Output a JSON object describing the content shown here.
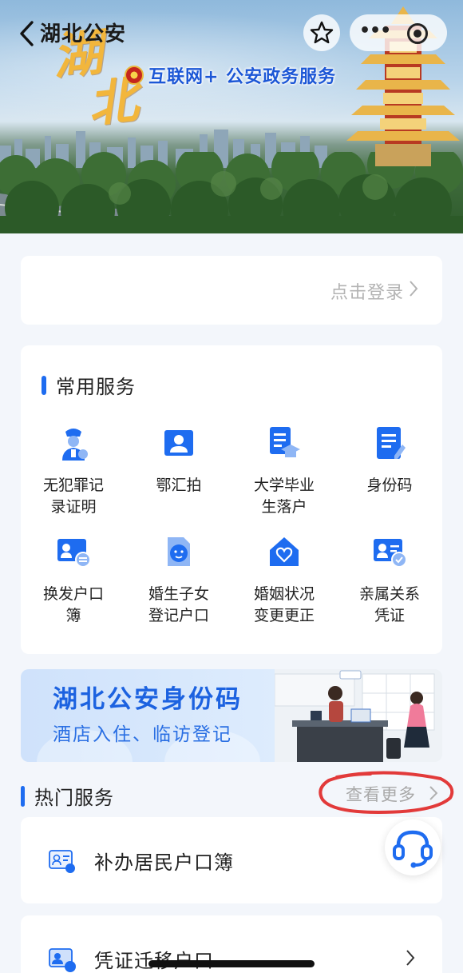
{
  "header": {
    "title": "湖北公安"
  },
  "banner": {
    "big_text_1": "湖",
    "big_text_2": "北",
    "slogan": "互联网+ 公安政务服务"
  },
  "login": {
    "label": "点击登录"
  },
  "common_services": {
    "title": "常用服务",
    "items": [
      {
        "label": "无犯罪记\n录证明",
        "icon": "police-officer-icon"
      },
      {
        "label": "鄂汇拍",
        "icon": "portrait-photo-icon"
      },
      {
        "label": "大学毕业\n生落户",
        "icon": "graduation-document-icon"
      },
      {
        "label": "身份码",
        "icon": "id-code-document-icon"
      },
      {
        "label": "换发户口\n簿",
        "icon": "household-register-icon"
      },
      {
        "label": "婚生子女\n登记户口",
        "icon": "child-registration-icon"
      },
      {
        "label": "婚姻状况\n变更更正",
        "icon": "marriage-house-icon"
      },
      {
        "label": "亲属关系\n凭证",
        "icon": "relative-certificate-icon"
      }
    ]
  },
  "promo": {
    "title": "湖北公安身份码",
    "subtitle": "酒店入住、临访登记"
  },
  "hot_services": {
    "title": "热门服务",
    "see_more": "查看更多",
    "items": [
      {
        "label": "补办居民户口簿",
        "icon": "household-book-icon"
      },
      {
        "label": "凭证迁移户口",
        "icon": "migration-certificate-icon"
      }
    ]
  },
  "colors": {
    "accent": "#1e6cf0",
    "annotation": "#e23a3a",
    "background": "#f3f6fb"
  }
}
